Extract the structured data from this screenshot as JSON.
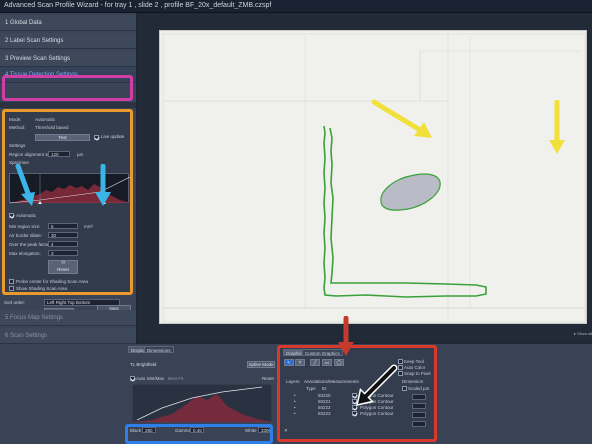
{
  "window": {
    "title": "Advanced Scan Profile Wizard -  for tray 1 , slide 2 , profile BF_20x_default_ZMB.czspf"
  },
  "wizard_steps": [
    {
      "label": "1  Global Data"
    },
    {
      "label": "2  Label Scan Settings"
    },
    {
      "label": "3  Preview Scan Settings"
    },
    {
      "label": "4  Tissue Detection Settings"
    },
    {
      "label": "5  Focus Map Settings"
    },
    {
      "label": "6  Scan Settings"
    }
  ],
  "tissue_settings": {
    "mode_label": "Mode:",
    "mode_value": "Automatic",
    "method_label": "Method:",
    "method_value": "Threshold based",
    "test_button": "Test",
    "live_update_label": "Live update",
    "settings_label": "Settings",
    "region_label": "Region alignment size:",
    "region_value": "120",
    "region_unit": "µm",
    "specimen_label": "Specimen",
    "automatic_label": "Automatic",
    "min_region_label": "Min region size:",
    "min_region_value": "5",
    "min_region_unit": "mm²",
    "air_border_label": "Air border dilate:",
    "air_border_value": "30",
    "peak_factor_label": "Over the peak factor:",
    "peak_factor_value": "4",
    "max_elongation_label": "Max elongation:",
    "max_elongation_value": "3",
    "reset_button": "Reset",
    "probe_label": "Probe center for Shading Scan Area",
    "show_shading_label": "Show Shading Scan Area"
  },
  "sort": {
    "label": "Sort order:",
    "value": "Left Right Top Bottom",
    "button": "Sort"
  },
  "next_button": "Next",
  "bottom_panel": {
    "tabs": [
      "Display",
      "Dimensions"
    ],
    "channel": "TL Brightfield",
    "spline_mode": "Spline Mode",
    "auto_label": "Auto",
    "minmax_label": "Min/Max",
    "bestfit_label": "Best Fit",
    "black_label": "Black",
    "black_value": "280",
    "gamma_label": "Gamma",
    "gamma_value": "0.45",
    "white_label": "White",
    "white_value": "3306",
    "reset_label": "Reset"
  },
  "graphics_panel": {
    "tabs": [
      "Graphics",
      "Custom Graphics"
    ],
    "keep_tool": "Keep Tool",
    "auto_color": "Auto Color",
    "snap_to_pixel": "Snap to Pixel",
    "layers_label": "Layers",
    "annotations_label": "Annotations/Measurements",
    "dimension_label": "Dimension",
    "scaled_label": "Scaled µm",
    "columns": [
      "Type",
      "ID"
    ],
    "rows": [
      {
        "id": "50220",
        "name": "Polygon Contour"
      },
      {
        "id": "50221",
        "name": "Polygon Contour"
      },
      {
        "id": "50222",
        "name": "Polygon Contour"
      },
      {
        "id": "50223",
        "name": "Polygon Contour"
      }
    ]
  },
  "colors": {
    "accent_magenta": "#d23ea8",
    "accent_orange": "#e89a2c",
    "accent_red": "#d8392b",
    "accent_blue": "#2f7fe8",
    "arrow_yellow": "#f2e03a",
    "arrow_cyan": "#3bb5e8",
    "contour_green": "#3aa13a"
  }
}
